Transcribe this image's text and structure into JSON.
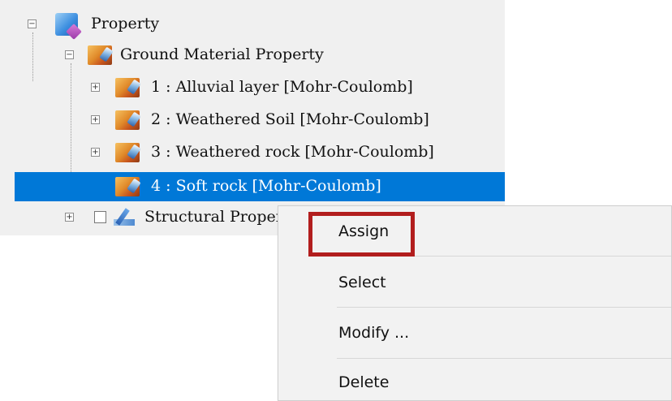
{
  "tree": {
    "root": {
      "label": "Property"
    },
    "ground_material": {
      "label": "Ground Material Property"
    },
    "materials": [
      {
        "label": "1 : Alluvial layer [Mohr-Coulomb]",
        "expander": "+"
      },
      {
        "label": "2 : Weathered Soil [Mohr-Coulomb]",
        "expander": "+"
      },
      {
        "label": "3 : Weathered rock [Mohr-Coulomb]",
        "expander": "+"
      },
      {
        "label": "4 : Soft rock [Mohr-Coulomb]",
        "selected": true
      }
    ],
    "structural": {
      "label": "Structural Proper",
      "expander": "+"
    },
    "expander_minus": "−"
  },
  "context_menu": {
    "items": [
      {
        "label": "Assign",
        "highlighted": true
      },
      {
        "label": "Select"
      },
      {
        "label": "Modify ..."
      },
      {
        "label": "Delete"
      }
    ]
  },
  "colors": {
    "selection": "#0078d7",
    "highlight_border": "#b21e1e",
    "menu_bg": "#f2f2f2",
    "tree_bg": "#f0f0f0"
  }
}
